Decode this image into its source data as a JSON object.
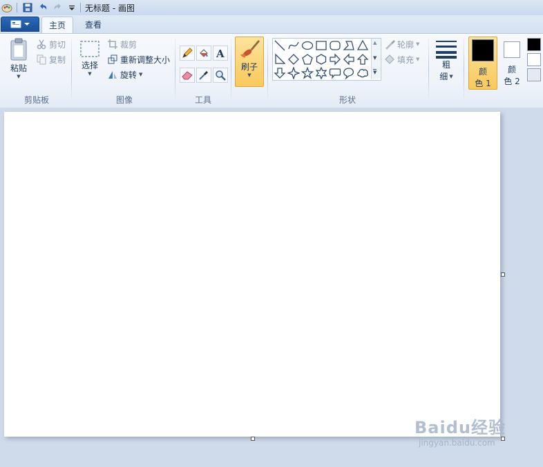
{
  "window": {
    "title": "无标题 - 画图"
  },
  "quick_access": {
    "icons": [
      "paint-app-icon",
      "save-icon",
      "undo-icon",
      "redo-icon",
      "customize-dropdown-icon"
    ]
  },
  "tabs": [
    {
      "label": "主页",
      "active": true
    },
    {
      "label": "查看",
      "active": false
    }
  ],
  "ribbon": {
    "clipboard": {
      "group_label": "剪贴板",
      "paste": "粘贴",
      "cut": "剪切",
      "copy": "复制"
    },
    "image": {
      "group_label": "图像",
      "select": "选择",
      "crop": "裁剪",
      "resize": "重新调整大小",
      "rotate": "旋转"
    },
    "tools": {
      "group_label": "工具"
    },
    "brush": {
      "label": "刷子"
    },
    "shapes": {
      "group_label": "形状",
      "outline": "轮廓",
      "fill": "填充"
    },
    "size": {
      "label_1": "粗",
      "label_2": "细"
    },
    "colors": {
      "color1_a": "颜",
      "color1_b": "色 1",
      "color2_a": "颜",
      "color2_b": "色 2",
      "color1_value": "#000000",
      "color2_value": "#ffffff"
    }
  },
  "watermark": {
    "logo": "Baidu经验",
    "url": "jingyan.baidu.com"
  }
}
